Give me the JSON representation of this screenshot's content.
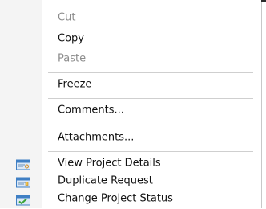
{
  "menu": {
    "items": [
      {
        "label": "Cut",
        "enabled": false
      },
      {
        "label": "Copy",
        "enabled": true
      },
      {
        "label": "Paste",
        "enabled": false
      },
      {
        "label": "Freeze",
        "enabled": true
      },
      {
        "label": "Comments...",
        "enabled": true
      },
      {
        "label": "Attachments...",
        "enabled": true
      },
      {
        "label": "View Project Details",
        "enabled": true,
        "icon": "project-details-icon"
      },
      {
        "label": "Duplicate Request",
        "enabled": true,
        "icon": "duplicate-request-icon"
      },
      {
        "label": "Change Project Status",
        "enabled": true,
        "icon": "change-status-icon"
      }
    ]
  },
  "colors": {
    "text": "#111111",
    "disabled_text": "#8c8c8c",
    "separator": "#cfcfcf",
    "icon_blue": "#3f7fc4",
    "icon_green": "#3aa33a"
  }
}
